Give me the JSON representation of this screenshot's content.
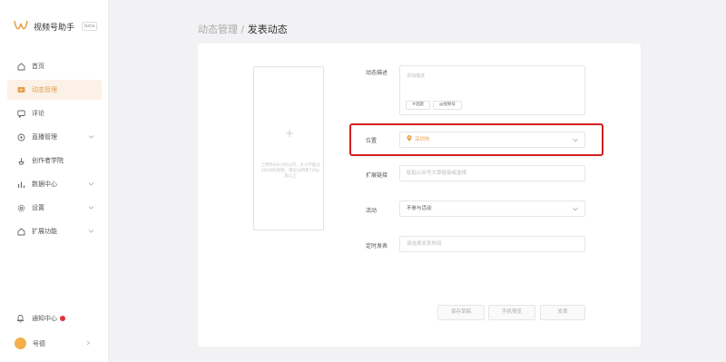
{
  "app": {
    "name": "视频号助手",
    "badge": "beta"
  },
  "sidebar": {
    "items": [
      {
        "label": "首页",
        "icon": "home-icon",
        "active": false
      },
      {
        "label": "动态管理",
        "icon": "video-icon",
        "active": true
      },
      {
        "label": "评论",
        "icon": "comment-icon",
        "active": false
      },
      {
        "label": "直播管理",
        "icon": "live-icon",
        "active": false,
        "expandable": true
      },
      {
        "label": "创作者学院",
        "icon": "academy-icon",
        "active": false
      },
      {
        "label": "数据中心",
        "icon": "chart-icon",
        "active": false,
        "expandable": true
      },
      {
        "label": "设置",
        "icon": "gear-icon",
        "active": false,
        "expandable": true
      },
      {
        "label": "扩展功能",
        "icon": "extension-icon",
        "active": false,
        "expandable": true
      }
    ],
    "notify_label": "通知中心",
    "account_label": "号德"
  },
  "breadcrumb": {
    "parent": "动态管理",
    "separator": " / ",
    "current": "发表动态"
  },
  "upload": {
    "plus": "+",
    "hint": "上传时长8小时以内，大小不超过20GB的视频，建议分辨率720p及以上"
  },
  "form": {
    "description_label": "动态描述",
    "description_placeholder": "添加描述",
    "tag_topic": "#话题",
    "tag_mention": "@视频号",
    "location_label": "位置",
    "location_value": "深圳市",
    "link_label": "扩展链接",
    "link_placeholder": "粘贴公众号文章链接或选择",
    "activity_label": "活动",
    "activity_value": "不参与活动",
    "schedule_label": "定时发表",
    "schedule_placeholder": "请选择发表时间"
  },
  "actions": {
    "save_draft": "保存草稿",
    "preview": "手机预览",
    "publish": "发表"
  },
  "colors": {
    "accent": "#e6a14a",
    "highlight": "#d42020",
    "active_bg": "#fbf1e6"
  }
}
